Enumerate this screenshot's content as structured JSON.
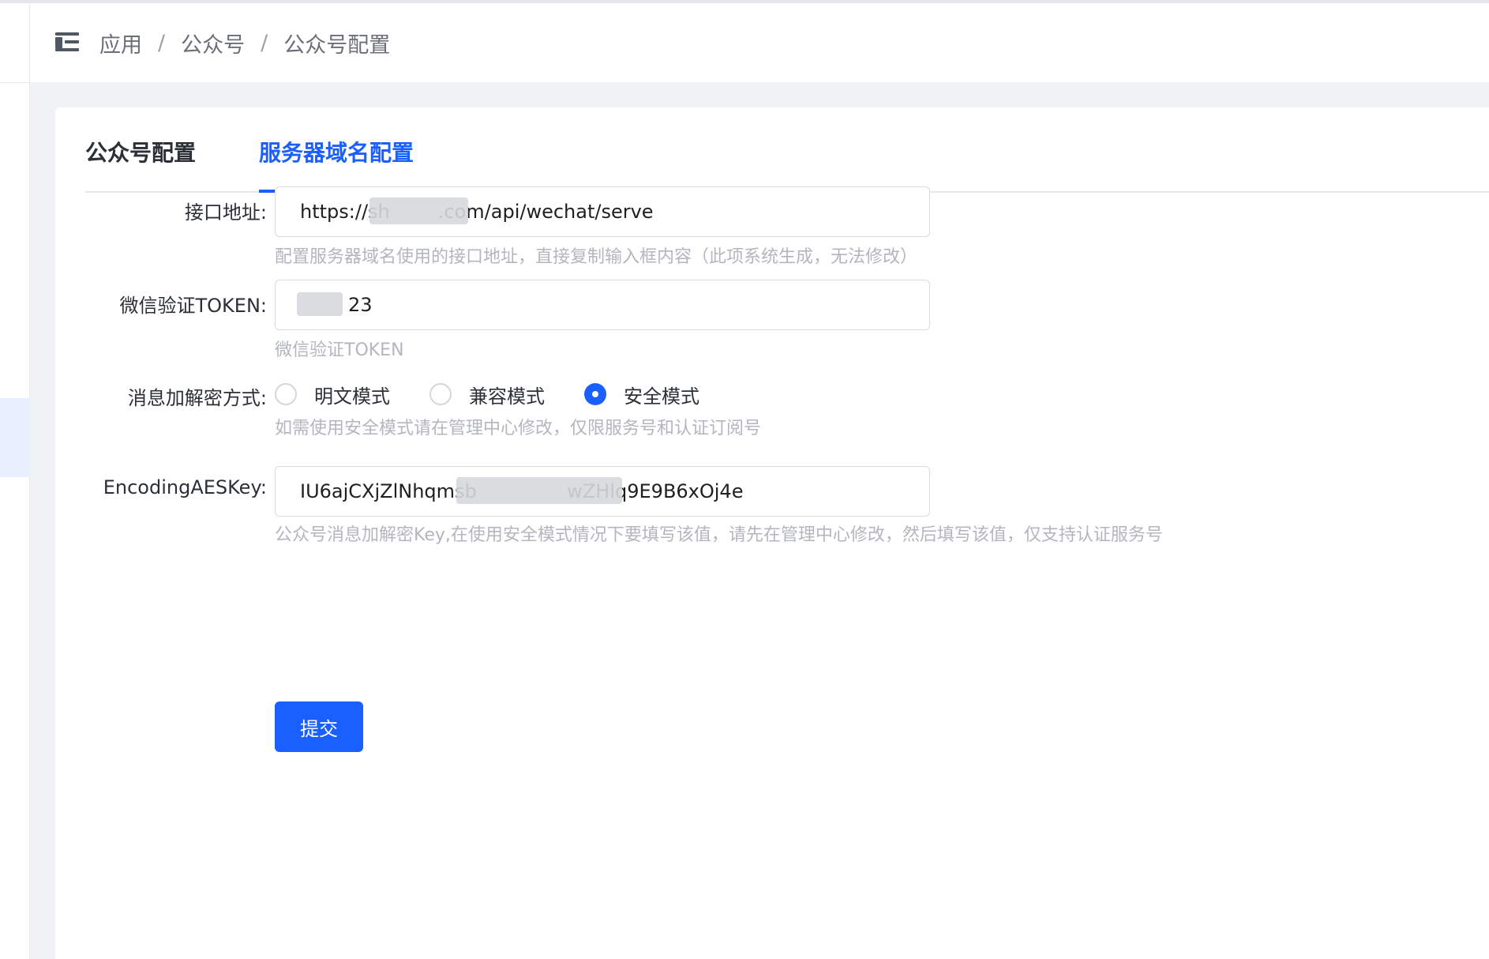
{
  "breadcrumb": {
    "items": [
      "应用",
      "公众号",
      "公众号配置"
    ],
    "separator": "/"
  },
  "tabs": [
    {
      "label": "公众号配置",
      "active": false
    },
    {
      "label": "服务器域名配置",
      "active": true
    }
  ],
  "form": {
    "api_url": {
      "label": "接口地址:",
      "value": "https://sh        .com/api/wechat/serve",
      "hint": "配置服务器域名使用的接口地址，直接复制输入框内容（此项系统生成，无法修改）"
    },
    "token": {
      "label": "微信验证TOKEN:",
      "value": "        23",
      "hint": "微信验证TOKEN"
    },
    "encryption": {
      "label": "消息加解密方式:",
      "options": [
        "明文模式",
        "兼容模式",
        "安全模式"
      ],
      "selected": "安全模式",
      "hint": "如需使用安全模式请在管理中心修改，仅限服务号和认证订阅号"
    },
    "aes_key": {
      "label": "EncodingAESKey:",
      "value": "IU6ajCXjZlNhqmsb               wZHlq9E9B6xOj4e",
      "hint": "公众号消息加解密Key,在使用安全模式情况下要填写该值，请先在管理中心修改，然后填写该值，仅支持认证服务号"
    },
    "submit_label": "提交"
  },
  "colors": {
    "primary": "#1a5fff",
    "hint": "#b3b6bc",
    "background": "#f0f2f5"
  },
  "icons": {
    "menu_toggle": "menu-fold-icon"
  }
}
